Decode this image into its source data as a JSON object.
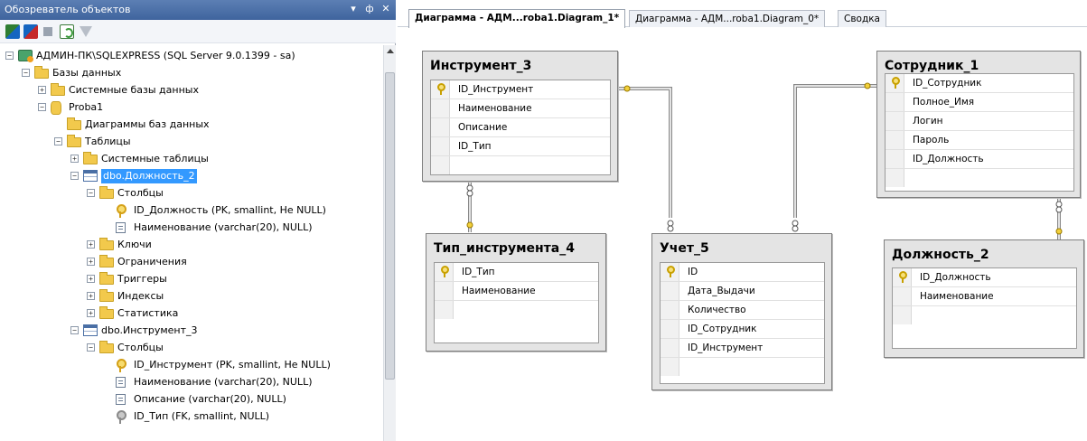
{
  "explorer": {
    "title": "Обозреватель объектов",
    "header_buttons": [
      "▾",
      "ф",
      "✕"
    ],
    "tree": [
      {
        "label": "АДМИН-ПК\\SQLEXPRESS (SQL Server 9.0.1399 - sa)",
        "icon": "server-icon",
        "expander": "⊟"
      },
      {
        "label": "Базы данных",
        "icon": "folder-icon",
        "expander": "⊟"
      },
      {
        "label": "Системные базы данных",
        "icon": "folder-icon",
        "expander": "⊞"
      },
      {
        "label": "Proba1",
        "icon": "database-icon",
        "expander": "⊟"
      },
      {
        "label": "Диаграммы баз данных",
        "icon": "folder-icon",
        "expander": ""
      },
      {
        "label": "Таблицы",
        "icon": "folder-icon",
        "expander": "⊟"
      },
      {
        "label": "Системные таблицы",
        "icon": "folder-icon",
        "expander": "⊞"
      },
      {
        "label": "dbo.Должность_2",
        "icon": "table-icon",
        "expander": "⊟",
        "selected": true
      },
      {
        "label": "Столбцы",
        "icon": "folder-icon",
        "expander": "⊟"
      },
      {
        "label": "ID_Должность (PK, smallint, Не NULL)",
        "icon": "primary-key-icon",
        "expander": ""
      },
      {
        "label": "Наименование (varchar(20), NULL)",
        "icon": "column-icon",
        "expander": ""
      },
      {
        "label": "Ключи",
        "icon": "folder-icon",
        "expander": "⊞"
      },
      {
        "label": "Ограничения",
        "icon": "folder-icon",
        "expander": "⊞"
      },
      {
        "label": "Триггеры",
        "icon": "folder-icon",
        "expander": "⊞"
      },
      {
        "label": "Индексы",
        "icon": "folder-icon",
        "expander": "⊞"
      },
      {
        "label": "Статистика",
        "icon": "folder-icon",
        "expander": "⊞"
      },
      {
        "label": "dbo.Инструмент_3",
        "icon": "table-icon",
        "expander": "⊟"
      },
      {
        "label": "Столбцы",
        "icon": "folder-icon",
        "expander": "⊟"
      },
      {
        "label": "ID_Инструмент (PK, smallint, Не NULL)",
        "icon": "primary-key-icon",
        "expander": ""
      },
      {
        "label": "Наименование (varchar(20), NULL)",
        "icon": "column-icon",
        "expander": ""
      },
      {
        "label": "Описание (varchar(20), NULL)",
        "icon": "column-icon",
        "expander": ""
      },
      {
        "label": "ID_Тип (FK, smallint, NULL)",
        "icon": "foreign-key-icon",
        "expander": ""
      }
    ]
  },
  "tabs": [
    {
      "label": "Диаграмма - АДМ...roba1.Diagram_1*",
      "active": true
    },
    {
      "label": "Диаграмма - АДМ...roba1.Diagram_0*",
      "active": false
    },
    {
      "label": "Сводка",
      "active": false
    }
  ],
  "diagram": {
    "tables": {
      "instrument": {
        "title": "Инструмент_3",
        "columns": [
          "ID_Инструмент",
          "Наименование",
          "Описание",
          "ID_Тип"
        ],
        "pk": [
          0
        ]
      },
      "employee": {
        "title": "Сотрудник_1",
        "columns": [
          "ID_Сотрудник",
          "Полное_Имя",
          "Логин",
          "Пароль",
          "ID_Должность"
        ],
        "pk": [
          0
        ]
      },
      "tooltype": {
        "title": "Тип_инструмента_4",
        "columns": [
          "ID_Тип",
          "Наименование"
        ],
        "pk": [
          0
        ]
      },
      "account": {
        "title": "Учет_5",
        "columns": [
          "ID",
          "Дата_Выдачи",
          "Количество",
          "ID_Сотрудник",
          "ID_Инструмент"
        ],
        "pk": [
          0
        ]
      },
      "position": {
        "title": "Должность_2",
        "columns": [
          "ID_Должность",
          "Наименование"
        ],
        "pk": [
          0
        ]
      }
    }
  }
}
